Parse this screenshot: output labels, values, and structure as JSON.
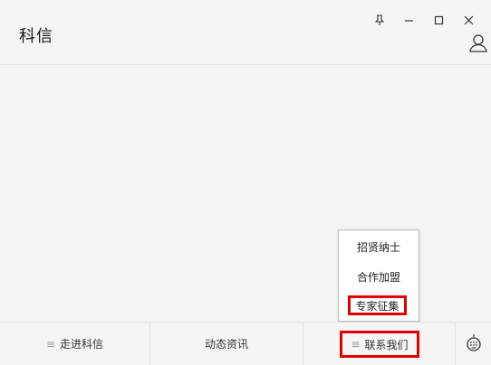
{
  "app": {
    "title": "科信"
  },
  "window_controls": {
    "pin_icon": "pin-icon",
    "minimize_icon": "minimize-icon",
    "maximize_icon": "maximize-icon",
    "close_icon": "close-icon",
    "user_icon": "user-icon"
  },
  "popup_menu": {
    "items": [
      {
        "label": "招贤纳士"
      },
      {
        "label": "合作加盟"
      },
      {
        "label": "专家征集"
      }
    ],
    "highlight_color": "#e00000"
  },
  "bottom_nav": {
    "tabs": [
      {
        "label": "走进科信",
        "icon": "menu-icon"
      },
      {
        "label": "动态资讯"
      },
      {
        "label": "联系我们",
        "icon": "menu-icon"
      }
    ],
    "keyboard_icon": "keyboard-icon"
  }
}
